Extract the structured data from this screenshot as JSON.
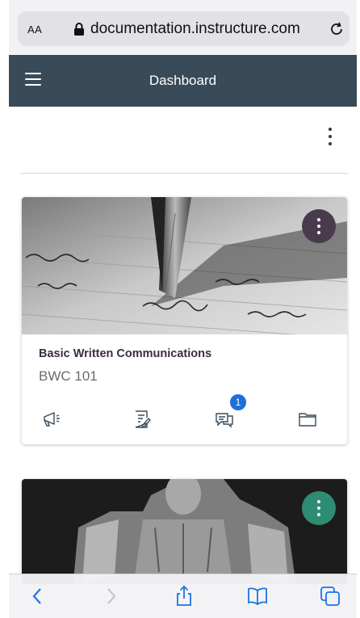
{
  "browser": {
    "text_size_label": "AA",
    "domain": "documentation.instructure.com",
    "icons": [
      "lock-icon",
      "reload-icon",
      "back-icon",
      "forward-icon",
      "share-icon",
      "bookmarks-icon",
      "tabs-icon"
    ]
  },
  "header": {
    "title": "Dashboard",
    "menu_icon": "hamburger-menu-icon",
    "background": "#394B58"
  },
  "courses": [
    {
      "name": "Basic Written Communications",
      "code": "BWC 101",
      "image": "fountain pen writing on paper",
      "menu_color": "#4A3A4D",
      "icons": [
        "announcements-icon",
        "assignments-icon",
        "discussions-icon",
        "files-icon"
      ],
      "discussions_badge": "1"
    },
    {
      "name": "",
      "code": "",
      "image": "seated marble statue",
      "menu_color": "#2E8B74"
    }
  ]
}
